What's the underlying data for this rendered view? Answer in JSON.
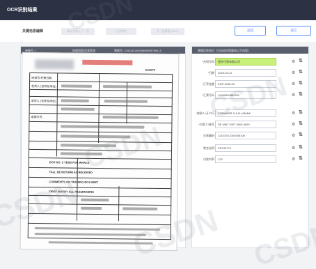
{
  "app": {
    "title": "OCR识别结果"
  },
  "toolbar": {
    "page_title": "关键信息编辑",
    "disabled_buttons": [
      "保存并进入下一页",
      "上传附件",
      "另一张票据 (EDIT)"
    ],
    "button_cancel": "返回",
    "button_save": "提交"
  },
  "left_panel": {
    "doc_id_label": "单据号 1",
    "status": "处理流程/信息状态",
    "doc_number": "票据号: 1240181202608089257864_8"
  },
  "document": {
    "code": "AA3574",
    "form_fields": [
      "申请号/开票日期",
      "发货人 (名称及地址)",
      "收货人 (名称及地址)",
      "运输方式",
      "BOX NO. 2 YESB FOR WHALE",
      "TALL BE RETURN AS RECEIVED",
      "COMMENTS ON TRADING BOX MINT",
      "FIRST NOTIFY ALL PASSENGERS"
    ]
  },
  "right_panel": {
    "header": "票据信息校对（已自动识别填充以下内容）",
    "fields": [
      {
        "label": "*合同号码",
        "value": "国外代表有限公司",
        "highlight": true
      },
      {
        "label": "*日期",
        "value": "2020-03-12",
        "highlight": false
      },
      {
        "label": "*汇率金额",
        "value": "EUR 4158.00",
        "highlight": false
      },
      {
        "label": "*汇票号码",
        "value": "12460304862501",
        "highlight": false
      },
      {
        "label": "*收款人/开户行",
        "value": "CORAMSR S.A.R.L/BANK",
        "highlight": false
      },
      {
        "label": "*付款人/账号",
        "value": "DE 9957 5327 0000 4829",
        "highlight": false
      },
      {
        "label": "交易编码",
        "value": "121010/12300155106",
        "highlight": false
      },
      {
        "label": "附言说明",
        "value": "FRSJ2774",
        "highlight": false
      },
      {
        "label": "付款利率",
        "value": "123",
        "highlight": false
      }
    ]
  },
  "icons": {
    "gear": "gear-icon",
    "tool": "ocr-tool-icon"
  },
  "watermarks": [
    "CSDN",
    "CSDN",
    "CSDN",
    "CSDN",
    "CSDN",
    "CSDN"
  ],
  "colors": {
    "topbar": "#2c3144",
    "accent": "#5b8ff9",
    "highlight": "#c8f07a",
    "panel_header": "#5a5f6e"
  }
}
